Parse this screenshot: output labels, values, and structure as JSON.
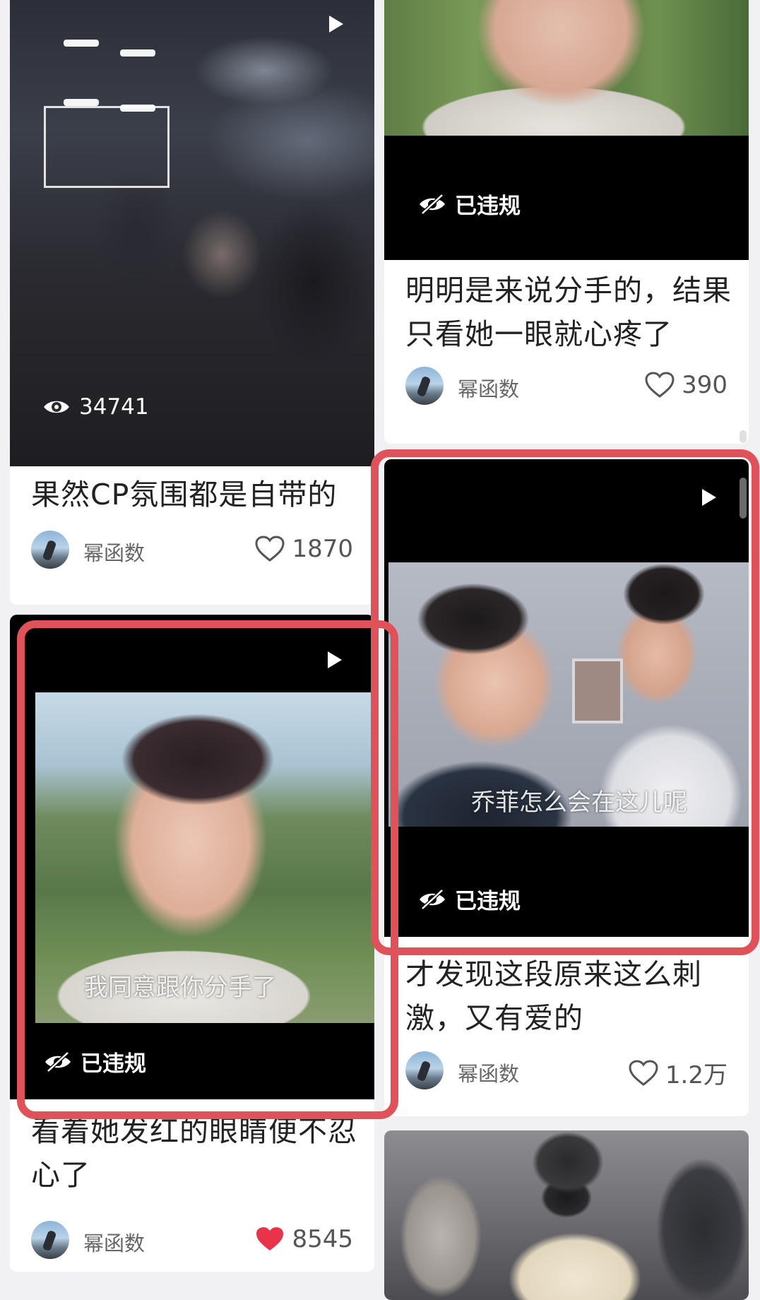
{
  "posts": [
    {
      "title": "果然CP氛围都是自带的",
      "views": "34741",
      "author": "幂函数",
      "likes": "1870",
      "liked": false
    },
    {
      "title": "明明是来说分手的，结果只看她一眼就心疼了",
      "status": "已违规",
      "author": "幂函数",
      "likes": "390",
      "liked": false
    },
    {
      "title": "看着她发红的眼睛便不忍心了",
      "subtitle": "我同意跟你分手了",
      "status": "已违规",
      "author": "幂函数",
      "likes": "8545",
      "liked": true
    },
    {
      "title": "才发现这段原来这么刺激，又有爱的",
      "subtitle": "乔菲怎么会在这儿呢",
      "status": "已违规",
      "author": "幂函数",
      "likes": "1.2万",
      "liked": false
    }
  ],
  "colors": {
    "highlight": "#e0525a",
    "like_red": "#e8334a",
    "background": "#f1f1f3"
  },
  "icons": {
    "play": "play-icon",
    "views": "eye-icon",
    "violation": "hidden-eye-icon",
    "like": "heart-icon"
  }
}
